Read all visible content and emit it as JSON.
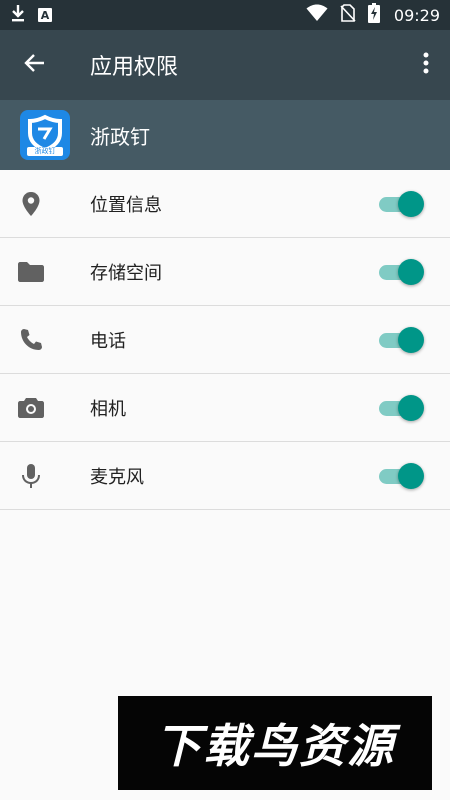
{
  "status_bar": {
    "time": "09:29",
    "icons": [
      "download-icon",
      "a-icon",
      "wifi-icon",
      "no-sim-icon",
      "battery-charging-icon"
    ],
    "a_label": "A"
  },
  "toolbar": {
    "title": "应用权限",
    "back_icon": "arrow-left-icon",
    "more_icon": "more-vert-icon"
  },
  "app": {
    "name": "浙政钉",
    "icon_label": "浙政钉",
    "icon_color": "#1e88e5"
  },
  "permissions": [
    {
      "label": "位置信息",
      "icon": "location-pin-icon",
      "enabled": true
    },
    {
      "label": "存储空间",
      "icon": "folder-icon",
      "enabled": true
    },
    {
      "label": "电话",
      "icon": "phone-icon",
      "enabled": true
    },
    {
      "label": "相机",
      "icon": "camera-icon",
      "enabled": true
    },
    {
      "label": "麦克风",
      "icon": "microphone-icon",
      "enabled": true
    }
  ],
  "watermark": {
    "text": "下载鸟资源"
  },
  "colors": {
    "status_bar": "#263238",
    "toolbar": "#37474f",
    "app_header": "#455a64",
    "toggle_on": "#009688",
    "toggle_track_on": "#80cbc4"
  }
}
